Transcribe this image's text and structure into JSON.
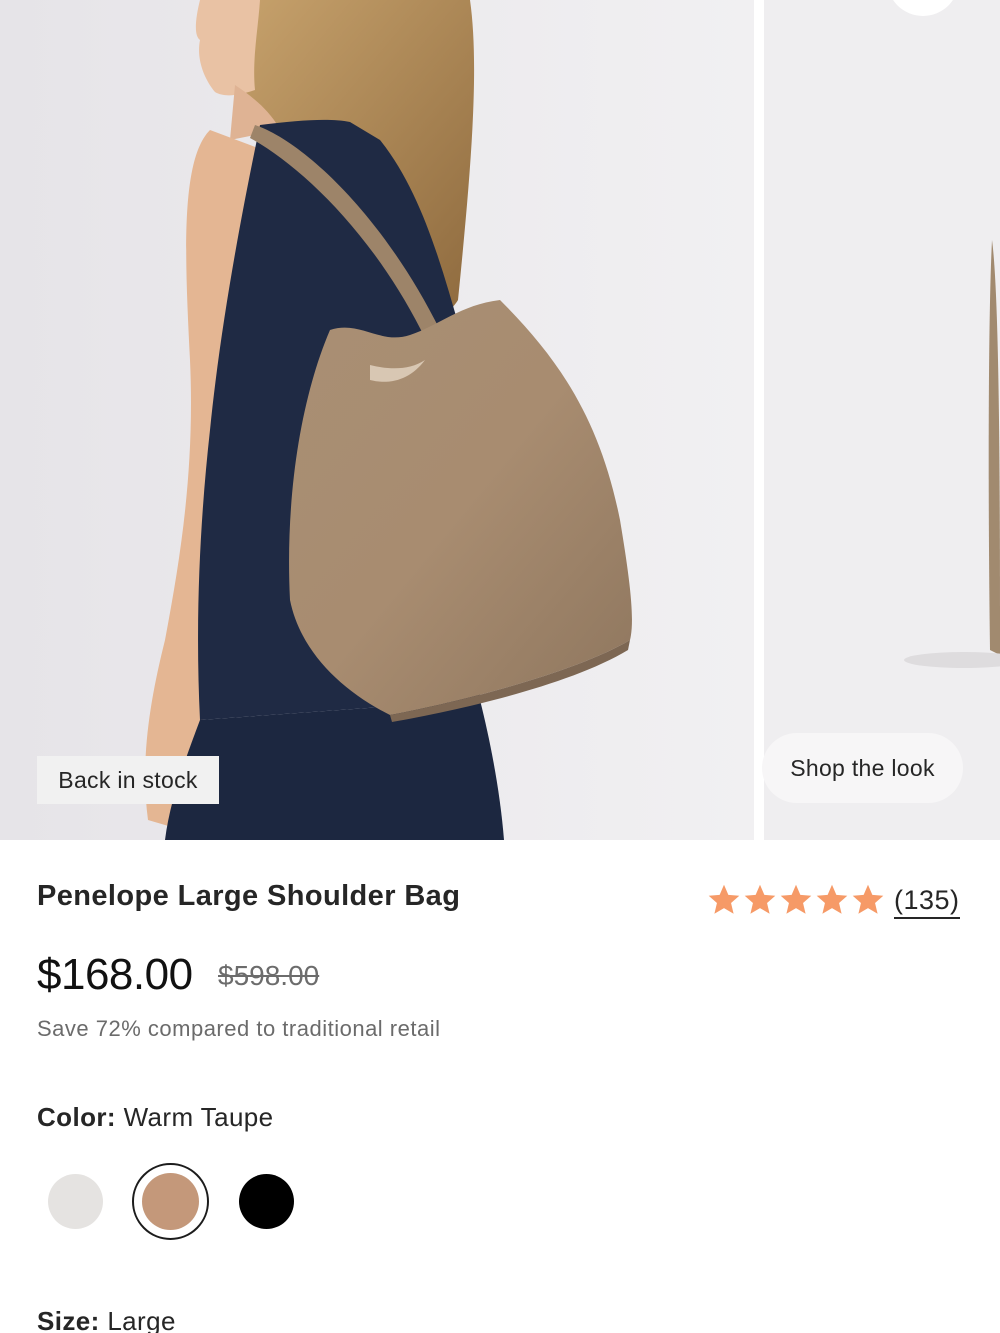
{
  "gallery": {
    "badge": "Back in stock",
    "shop_the_look": "Shop the look"
  },
  "product": {
    "title": "Penelope Large Shoulder Bag",
    "rating": 5,
    "review_count": "(135)",
    "price": "$168.00",
    "compare_price": "$598.00",
    "savings_text": "Save 72% compared to traditional retail",
    "star_color": "#f69a67"
  },
  "color": {
    "label": "Color:",
    "selected": "Warm Taupe",
    "swatches": [
      {
        "name": "light-grey",
        "hex": "#e5e3e1"
      },
      {
        "name": "warm-taupe",
        "hex": "#c4987a",
        "selected": true
      },
      {
        "name": "black",
        "hex": "#000000"
      }
    ]
  },
  "size": {
    "label": "Size:",
    "selected": "Large"
  }
}
